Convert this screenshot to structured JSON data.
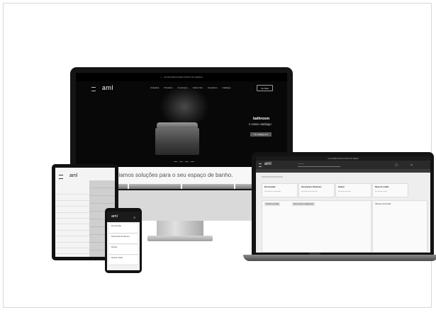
{
  "desktop": {
    "logo": "aml",
    "top_notice": "ACCESSIBILIDADE PORTO NO SERRA",
    "nav": [
      "Coleções",
      "Produtos",
      "Novidades",
      "Sobre Nós",
      "Contactos",
      "Catálogo"
    ],
    "nav_button": "Ver Mais",
    "hero_title": "bathroom",
    "hero_subtitle": "o nosso catálogo",
    "hero_button": "Ver catálogo aml",
    "banner_text": "Criamos soluções para o seu espaço de banho."
  },
  "tablet": {
    "logo": "aml",
    "menu_count": 11,
    "right_items_count": 10
  },
  "phone": {
    "logo": "aml",
    "cards": [
      "Encomendas",
      "Documentos Pendentes",
      "Faturas",
      "Nota de crédito"
    ]
  },
  "laptop": {
    "logo": "aml",
    "top_notice": "ACCESSIBILIDADE PORTO NO SERRA",
    "search_placeholder": "Pesquisa",
    "cards": [
      {
        "title": "Encomendas",
        "sub": "Ver todas as encomendas"
      },
      {
        "title": "Documentos Pendentes",
        "sub": "Ver todos os documentos"
      },
      {
        "title": "Faturas",
        "sub": "Ver todas as faturas"
      },
      {
        "title": "Notas de crédito",
        "sub": "Ver todas as notas"
      }
    ],
    "panel_tabs": [
      "Faturas vencidas",
      "Documentos a pagamento"
    ],
    "side_panel_title": "Últimas encomendas"
  }
}
